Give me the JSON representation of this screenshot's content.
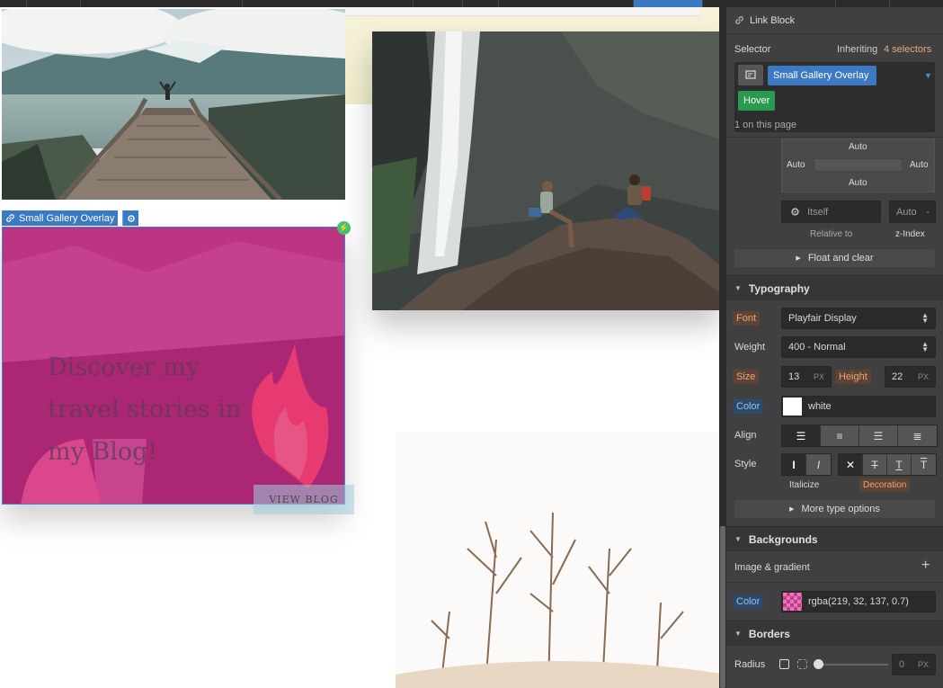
{
  "canvas": {
    "selection_tag": "Small Gallery Overlay",
    "overlay": {
      "headline": "Discover my travel stories in my Blog!",
      "button": "VIEW BLOG"
    }
  },
  "panel": {
    "element_type": "Link Block",
    "selector": {
      "label": "Selector",
      "inheriting_prefix": "Inheriting",
      "inheriting_count": "4 selectors",
      "class_chip": "Small Gallery Overlay",
      "state_chip": "Hover",
      "on_page": "1 on this page"
    },
    "position": {
      "top": "Auto",
      "left": "Auto",
      "right": "Auto",
      "bottom": "Auto",
      "relative_value": "Itself",
      "relative_label": "Relative to",
      "z_value": "Auto",
      "z_dash": "-",
      "z_label": "z-Index",
      "float_button": "Float and clear"
    },
    "typography": {
      "title": "Typography",
      "font_label": "Font",
      "font_value": "Playfair Display",
      "weight_label": "Weight",
      "weight_value": "400 - Normal",
      "size_label": "Size",
      "size_value": "13",
      "size_unit": "PX",
      "height_label": "Height",
      "height_value": "22",
      "height_unit": "PX",
      "color_label": "Color",
      "color_value": "white",
      "align_label": "Align",
      "style_label": "Style",
      "italicize_label": "Italicize",
      "decoration_label": "Decoration",
      "more_button": "More type options"
    },
    "backgrounds": {
      "title": "Backgrounds",
      "image_label": "Image & gradient",
      "color_label": "Color",
      "color_value": "rgba(219, 32, 137, 0.7)"
    },
    "borders": {
      "title": "Borders",
      "radius_label": "Radius",
      "radius_value": "0",
      "radius_unit": "PX"
    }
  },
  "colors": {
    "accent_blue": "#3b79c3",
    "hover_green": "#2a9a4e",
    "overlay": "rgba(219,32,137,0.7)",
    "orange_label": "#e5a87f"
  }
}
